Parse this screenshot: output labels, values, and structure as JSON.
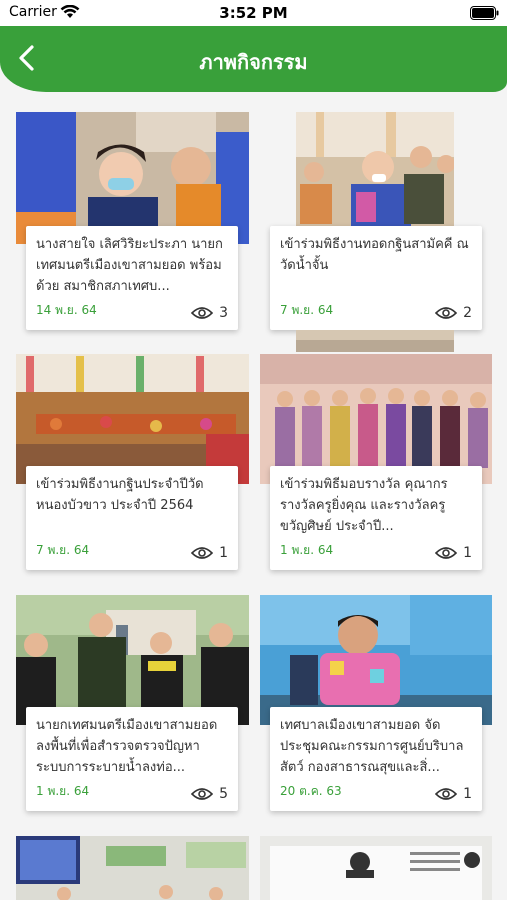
{
  "status_bar": {
    "carrier": "Carrier",
    "time": "3:52 PM"
  },
  "header": {
    "title": "ภาพกิจกรรม"
  },
  "activities": [
    {
      "title": "นางสายใจ เลิศวิริยะประภา นายกเทศมนตรีเมืองเขาสามยอด พร้อมด้วย สมาชิกสภาเทศบ...",
      "date": "14 พ.ย. 64",
      "views": "3"
    },
    {
      "title": "เข้าร่วมพิธีงานทอดกฐินสามัคคี ณ วัดน้ำจั้น",
      "date": "7 พ.ย. 64",
      "views": "2"
    },
    {
      "title": "เข้าร่วมพิธีงานกฐินประจำปีวัดหนองบัวขาว ประจำปี 2564",
      "date": "7 พ.ย. 64",
      "views": "1"
    },
    {
      "title": "เข้าร่วมพิธีมอบรางวัล คุณากรรางวัลครูยิ่งคุณ และรางวัลครูขวัญศิษย์ ประจำปี...",
      "date": "1 พ.ย. 64",
      "views": "1"
    },
    {
      "title": "นายกเทศมนตรีเมืองเขาสามยอดลงพื้นที่เพื่อสำรวจตรวจปัญหาระบบการระบายน้ำลงท่อ...",
      "date": "1 พ.ย. 64",
      "views": "5"
    },
    {
      "title": "เทศบาลเมืองเขาสามยอด จัดประชุมคณะกรรมการศูนย์บริบาลสัตว์ กองสาธารณสุขและสิ่...",
      "date": "20 ต.ค. 63",
      "views": "1"
    }
  ],
  "colors": {
    "brand_green": "#39a03a",
    "date_green": "#3aa03a"
  }
}
